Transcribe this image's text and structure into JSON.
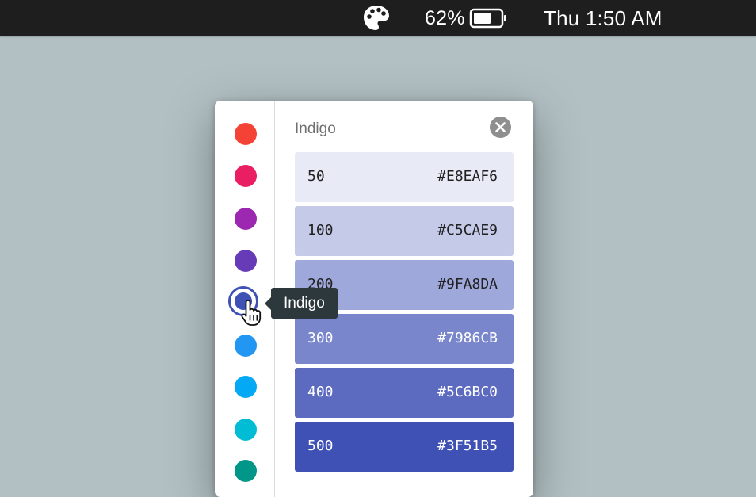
{
  "menubar": {
    "app_icon": "palette-icon",
    "battery_percent": "62%",
    "battery_level": 0.62,
    "clock": "Thu 1:50 AM"
  },
  "rail": {
    "colors": [
      {
        "name": "Red",
        "hex": "#F44336"
      },
      {
        "name": "Pink",
        "hex": "#E91E63"
      },
      {
        "name": "Purple",
        "hex": "#9C27B0"
      },
      {
        "name": "Deep Purple",
        "hex": "#673AB7"
      },
      {
        "name": "Indigo",
        "hex": "#3F51B5",
        "selected": true
      },
      {
        "name": "Blue",
        "hex": "#2196F3"
      },
      {
        "name": "Light Blue",
        "hex": "#03A9F4"
      },
      {
        "name": "Cyan",
        "hex": "#00BCD4"
      },
      {
        "name": "Teal",
        "hex": "#009688"
      }
    ],
    "tooltip": "Indigo"
  },
  "panel": {
    "title": "Indigo",
    "close_icon": "close-icon",
    "swatches": [
      {
        "shade": "50",
        "hex": "#E8EAF6",
        "text_color": "#212121"
      },
      {
        "shade": "100",
        "hex": "#C5CAE9",
        "text_color": "#212121"
      },
      {
        "shade": "200",
        "hex": "#9FA8DA",
        "text_color": "#212121"
      },
      {
        "shade": "300",
        "hex": "#7986CB",
        "text_color": "#ffffff"
      },
      {
        "shade": "400",
        "hex": "#5C6BC0",
        "text_color": "#ffffff"
      },
      {
        "shade": "500",
        "hex": "#3F51B5",
        "text_color": "#ffffff"
      }
    ]
  }
}
